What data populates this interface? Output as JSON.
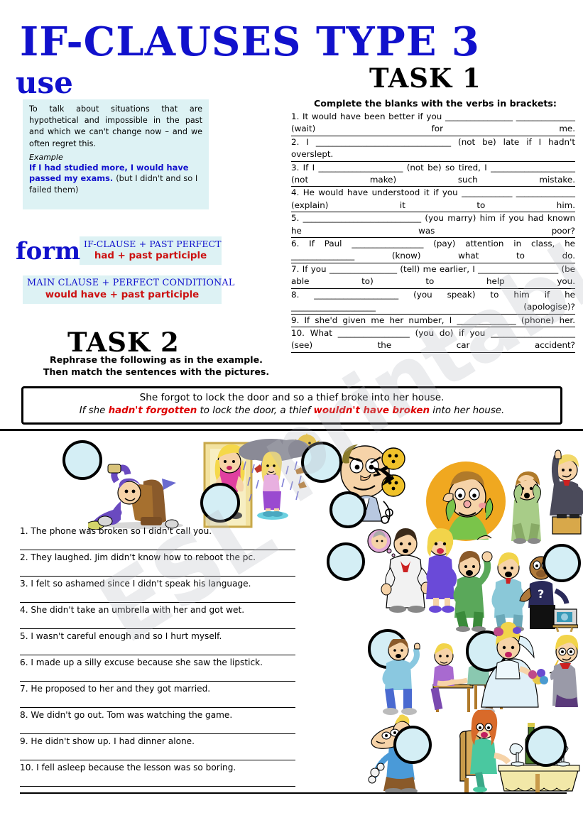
{
  "worksheet": {
    "title": "IF-CLAUSES TYPE 3",
    "keyword_use": "use",
    "keyword_form": "form"
  },
  "use_box": {
    "body": "To talk about situations that are hypothetical and impossible in the past and which we can't change now – and we often regret this.",
    "example_label": "Example",
    "example_bold": "If I had studied more, I would have passed my exams.",
    "example_plain": "(but I didn't and so I failed them)"
  },
  "form_boxes": [
    {
      "structure": "IF-CLAUSE + PAST PERFECT",
      "formula": "had + past participle"
    },
    {
      "structure": "MAIN CLAUSE + PERFECT CONDITIONAL",
      "formula": "would have + past participle"
    }
  ],
  "task1": {
    "heading": "TASK 1",
    "instruction": "Complete the blanks with the verbs in brackets:",
    "items": [
      "1. It would have been better if you ________________ ______________ (wait) for me.",
      "2. I ________________________________ (not be) late if I hadn't overslept.",
      "3. If I ____________________ (not be) so tired, I ____________________ (not make) such mistake.",
      "4. He would have understood it if you ____________ ______________ (explain) it to him.",
      "5. ____________________________ (you marry) him if you had known he was poor?",
      "6. If Paul _________________ (pay) attention in class, he _______________ (know) what to do.",
      "7. If you ________________ (tell) me earlier, I ___________________ (be able to) to help you.",
      "8. ____________________ (you speak) to him if he ____________________ (apologise)?",
      "9. If she'd given me her number, I ______________ (phone) her.",
      "10. What _________________ (you do) if you ____________________ (see) the car accident?"
    ]
  },
  "task2": {
    "heading": "TASK 2",
    "instruction_line1": "Rephrase the following as in the example.",
    "instruction_line2": "Then match the sentences with the pictures.",
    "example_original": "She forgot to lock the door and so a thief broke into her house.",
    "example_rewrite_parts": [
      {
        "text": "If she ",
        "highlight": false
      },
      {
        "text": "hadn't forgotten",
        "highlight": true
      },
      {
        "text": " to lock the door, a thief ",
        "highlight": false
      },
      {
        "text": "wouldn't have broken",
        "highlight": true
      },
      {
        "text": " into her house.",
        "highlight": false
      }
    ],
    "sentences": [
      "1. The phone was broken so I didn't call you.",
      "2. They laughed. Jim didn't know how to reboot the pc.",
      "3.  I felt so ashamed since I didn't speak his language.",
      "4. She didn't take an umbrella with her and got wet.",
      "5. I wasn't careful enough and so I hurt myself.",
      "6. I made up a silly excuse because she saw the lipstick.",
      "7. He proposed to her and they got married.",
      "8. We didn't go out. Tom was watching the game.",
      "9. He didn't show up. I had dinner alone.",
      "10. I fell asleep because the lesson was so boring."
    ]
  },
  "illustrations": {
    "answer_circle_label": "",
    "scenes": [
      "man-hurt-falling-off-chair",
      "woman-in-doorway-lipstick",
      "woman-in-rain-no-umbrella",
      "angry-man-broken-phone",
      "embarrassed-man-ashamed",
      "man-pointing-speech",
      "doctor-and-woman-arguing",
      "men-laughing-at-computer",
      "man-telling-off-students",
      "bride-and-groom-wedding",
      "sleeping-man-boring-lesson",
      "woman-alone-at-dinner-table"
    ]
  },
  "watermark": {
    "line1": "ESL",
    "line2": "printables.com"
  },
  "colors": {
    "title_blue": "#1111CC",
    "formula_red": "#CC1111",
    "highlight_red": "#DD0000",
    "panel_tint": "#DDF2F4",
    "circle_fill": "#D4EEF5",
    "ink_black": "#000000"
  }
}
